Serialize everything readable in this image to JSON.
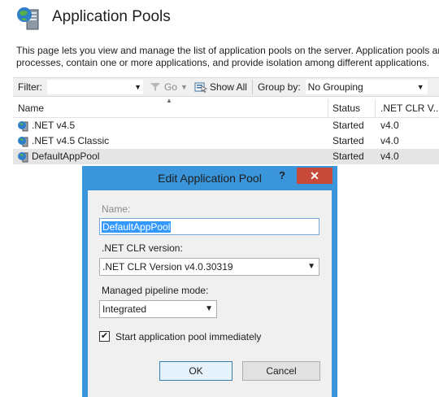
{
  "page": {
    "title": "Application Pools",
    "description_line1": "This page lets you view and manage the list of application pools on the server. Application pools are",
    "description_line2": "processes, contain one or more applications, and provide isolation among different applications."
  },
  "filterbar": {
    "filter_label": "Filter:",
    "filter_value": "",
    "go_label": "Go",
    "show_all_label": "Show All",
    "group_by_label": "Group by:",
    "group_by_value": "No Grouping"
  },
  "list": {
    "columns": [
      "Name",
      "Status",
      ".NET CLR V..."
    ],
    "rows": [
      {
        "name": ".NET v4.5",
        "status": "Started",
        "clr": "v4.0"
      },
      {
        "name": ".NET v4.5 Classic",
        "status": "Started",
        "clr": "v4.0"
      },
      {
        "name": "DefaultAppPool",
        "status": "Started",
        "clr": "v4.0"
      }
    ]
  },
  "dialog": {
    "title": "Edit Application Pool",
    "help_label": "?",
    "close_label": "✕",
    "name_label": "Name:",
    "name_value": "DefaultAppPool",
    "clr_label": ".NET CLR version:",
    "clr_value": ".NET CLR Version v4.0.30319",
    "pipeline_label": "Managed pipeline mode:",
    "pipeline_value": "Integrated",
    "start_checkbox_label": "Start application pool immediately",
    "start_checked": true,
    "ok_label": "OK",
    "cancel_label": "Cancel"
  }
}
